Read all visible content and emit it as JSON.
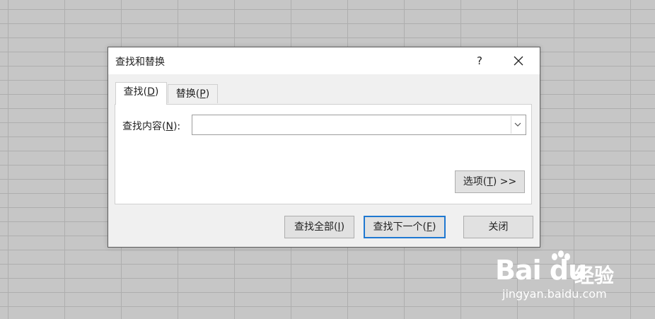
{
  "dialog": {
    "title": "查找和替换",
    "help_label": "?",
    "tabs": [
      {
        "label_pre": "查找(",
        "label_key": "D",
        "label_post": ")",
        "active": true
      },
      {
        "label_pre": "替换(",
        "label_key": "P",
        "label_post": ")",
        "active": false
      }
    ],
    "find": {
      "label_pre": "查找内容(",
      "label_key": "N",
      "label_post": "):",
      "value": ""
    },
    "options_button": {
      "pre": "选项(",
      "key": "T",
      "post": ") >>"
    },
    "find_all_button": {
      "pre": "查找全部(",
      "key": "I",
      "post": ")"
    },
    "find_next_button": {
      "pre": "查找下一个(",
      "key": "F",
      "post": ")"
    },
    "close_button": "关闭"
  },
  "watermark": {
    "brand": "Bai du",
    "cn": "经验",
    "url": "jingyan.baidu.com"
  },
  "colors": {
    "background": "#c6c6c6",
    "dialog_bg": "#f0f0f0",
    "accent": "#1f78d1"
  }
}
